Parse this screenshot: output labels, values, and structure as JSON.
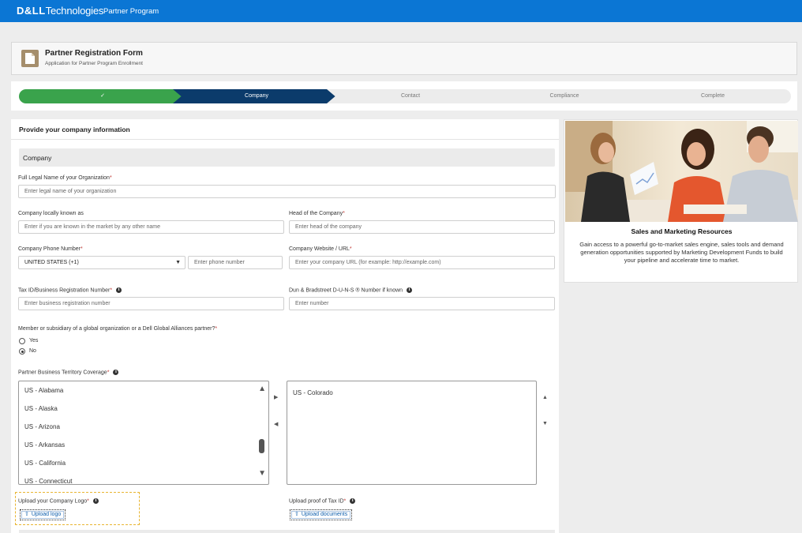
{
  "topbar": {
    "brand_strong": "D&LL",
    "brand_rest": "Technologies",
    "program": "Partner Program"
  },
  "header": {
    "title": "Partner Registration Form",
    "subtitle": "Application for Partner Program Enrollment"
  },
  "progress": {
    "steps": [
      {
        "label": "✓",
        "state": "done"
      },
      {
        "label": "Company",
        "state": "current"
      },
      {
        "label": "Contact",
        "state": "todo"
      },
      {
        "label": "Compliance",
        "state": "todo"
      },
      {
        "label": "Complete",
        "state": "todo"
      }
    ]
  },
  "form": {
    "heading": "Provide your company information",
    "section": "Company",
    "legal_name": {
      "label": "Full Legal Name of your Organization",
      "placeholder": "Enter legal name of your organization"
    },
    "known_as": {
      "label": "Company locally known as",
      "placeholder": "Enter if you are known in the market by any other name"
    },
    "head": {
      "label": "Head of the Company",
      "placeholder": "Enter head of the company"
    },
    "phone": {
      "label": "Company Phone Number",
      "country": "UNITED STATES (+1)",
      "placeholder": "Enter phone number"
    },
    "website": {
      "label": "Company Website / URL",
      "placeholder": "Enter your company URL (for example: http://example.com)"
    },
    "tax_id": {
      "label": "Tax ID/Business Registration Number",
      "placeholder": "Enter business registration number"
    },
    "duns": {
      "label": "Dun & Bradstreet D-U-N-S ® Number if known",
      "placeholder": "Enter number"
    },
    "member": {
      "question": "Member or subsidiary of a global organization or a Dell Global Alliances partner?",
      "options": [
        "Yes",
        "No"
      ],
      "selected": "No"
    },
    "territory": {
      "label": "Partner Business Territory Coverage",
      "available": [
        "US - Alabama",
        "US - Alaska",
        "US - Arizona",
        "US - Arkansas",
        "US - California",
        "US - Connecticut"
      ],
      "selected": [
        "US - Colorado"
      ]
    },
    "logo": {
      "label": "Upload your Company Logo",
      "button": "Upload logo"
    },
    "tax_proof": {
      "label": "Upload proof of Tax ID",
      "button": "Upload documents"
    },
    "required_mark": "*"
  },
  "promo": {
    "title": "Sales and Marketing Resources",
    "text": "Gain access to a powerful go-to-market sales engine, sales tools and demand generation opportunities supported by Marketing Development Funds to build your pipeline and accelerate time to market."
  },
  "colors": {
    "topbar": "#0b76d4",
    "step_done": "#3aa34c",
    "step_current": "#0b3b6b",
    "focus_outline": "#e8b532"
  }
}
